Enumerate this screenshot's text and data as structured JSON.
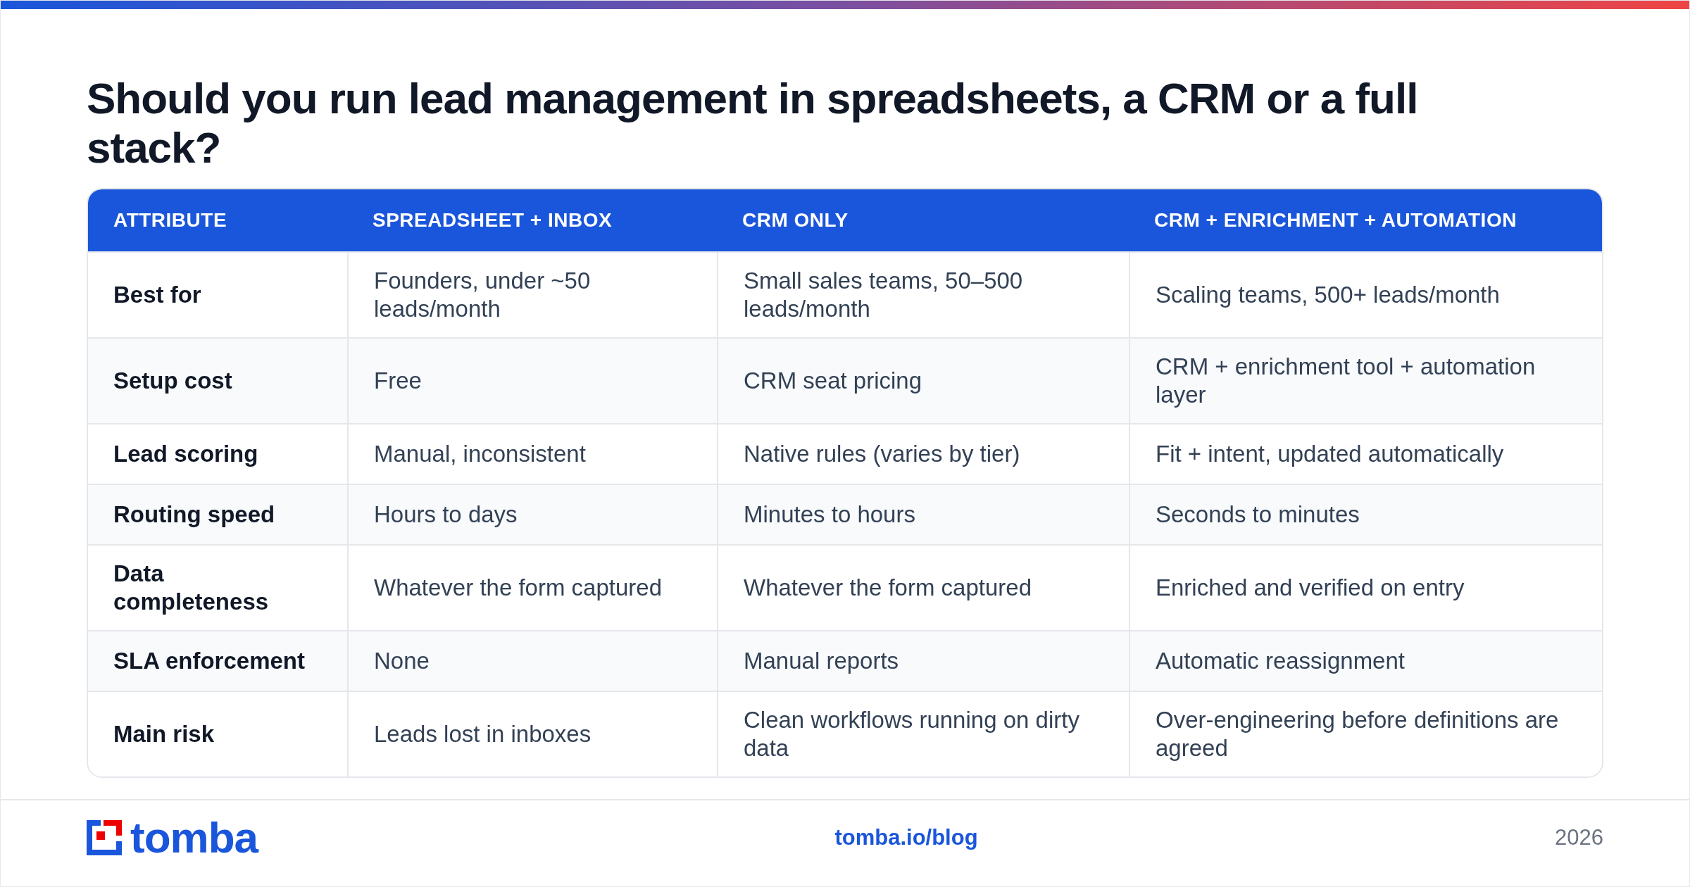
{
  "title": "Should you run lead management in spreadsheets, a CRM or a full stack?",
  "table": {
    "columns": [
      "ATTRIBUTE",
      "SPREADSHEET + INBOX",
      "CRM ONLY",
      "CRM + ENRICHMENT + AUTOMATION"
    ],
    "rows": [
      [
        "Best for",
        "Founders, under ~50 leads/month",
        "Small sales teams, 50–500 leads/month",
        "Scaling teams, 500+ leads/month"
      ],
      [
        "Setup cost",
        "Free",
        "CRM seat pricing",
        "CRM + enrichment tool + automation layer"
      ],
      [
        "Lead scoring",
        "Manual, inconsistent",
        "Native rules (varies by tier)",
        "Fit + intent, updated automatically"
      ],
      [
        "Routing speed",
        "Hours to days",
        "Minutes to hours",
        "Seconds to minutes"
      ],
      [
        "Data completeness",
        "Whatever the form captured",
        "Whatever the form captured",
        "Enriched and verified on entry"
      ],
      [
        "SLA enforcement",
        "None",
        "Manual reports",
        "Automatic reassignment"
      ],
      [
        "Main risk",
        "Leads lost in inboxes",
        "Clean workflows running on dirty data",
        "Over-engineering before definitions are agreed"
      ]
    ]
  },
  "footer": {
    "brand": "tomba",
    "link": "tomba.io/blog",
    "year": "2026"
  }
}
